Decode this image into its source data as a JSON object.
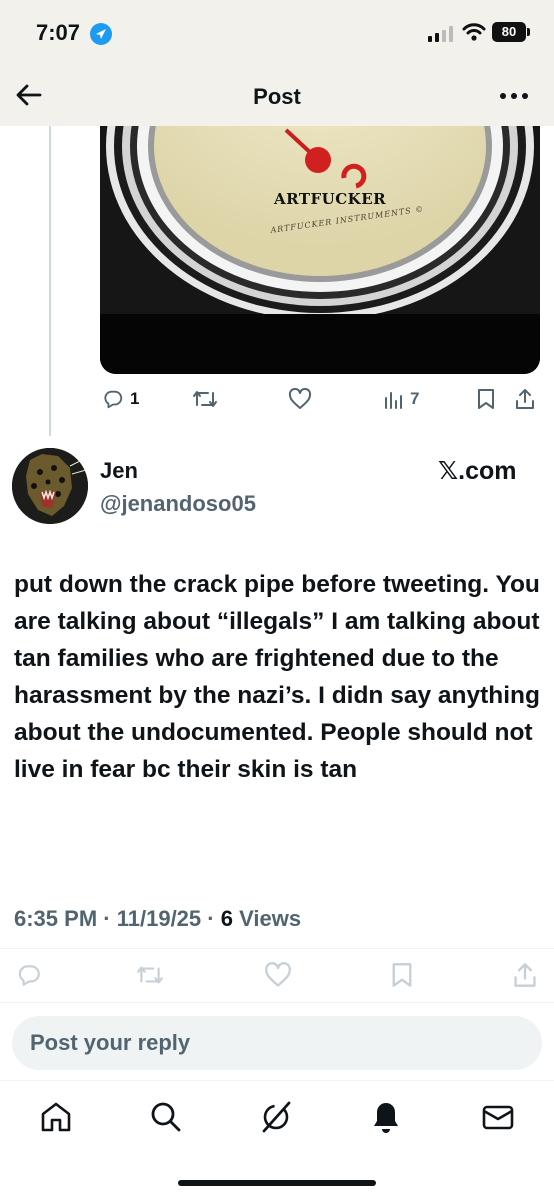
{
  "status_bar": {
    "time": "7:07",
    "battery": "80"
  },
  "nav": {
    "title": "Post"
  },
  "media": {
    "gauge_brand": "ARTFUCKER",
    "gauge_subtext": "ARTFUCKER INSTRUMENTS ©"
  },
  "parent_actions": {
    "replies": "1",
    "views": "7"
  },
  "tweet": {
    "author_name": "Jen",
    "author_handle": "@jenandoso05",
    "site_label": "𝕏.com",
    "text": "put down the crack pipe before tweeting. You are talking about “illegals” I am talking about tan families who are frightened due to the harassment by the nazi’s. I didn say anything about the undocumented. People should not live in fear bc their skin is tan",
    "time": "6:35 PM",
    "date": "11/19/25",
    "views_count": "6",
    "views_label": "Views"
  },
  "reply": {
    "placeholder": "Post your reply"
  },
  "tabs": [
    "home",
    "search",
    "grok",
    "notifications",
    "messages"
  ],
  "colors": {
    "accent": "#1d9bf0",
    "text": "#0f1419",
    "muted": "#536471",
    "header_bg": "#f2f1ec"
  }
}
